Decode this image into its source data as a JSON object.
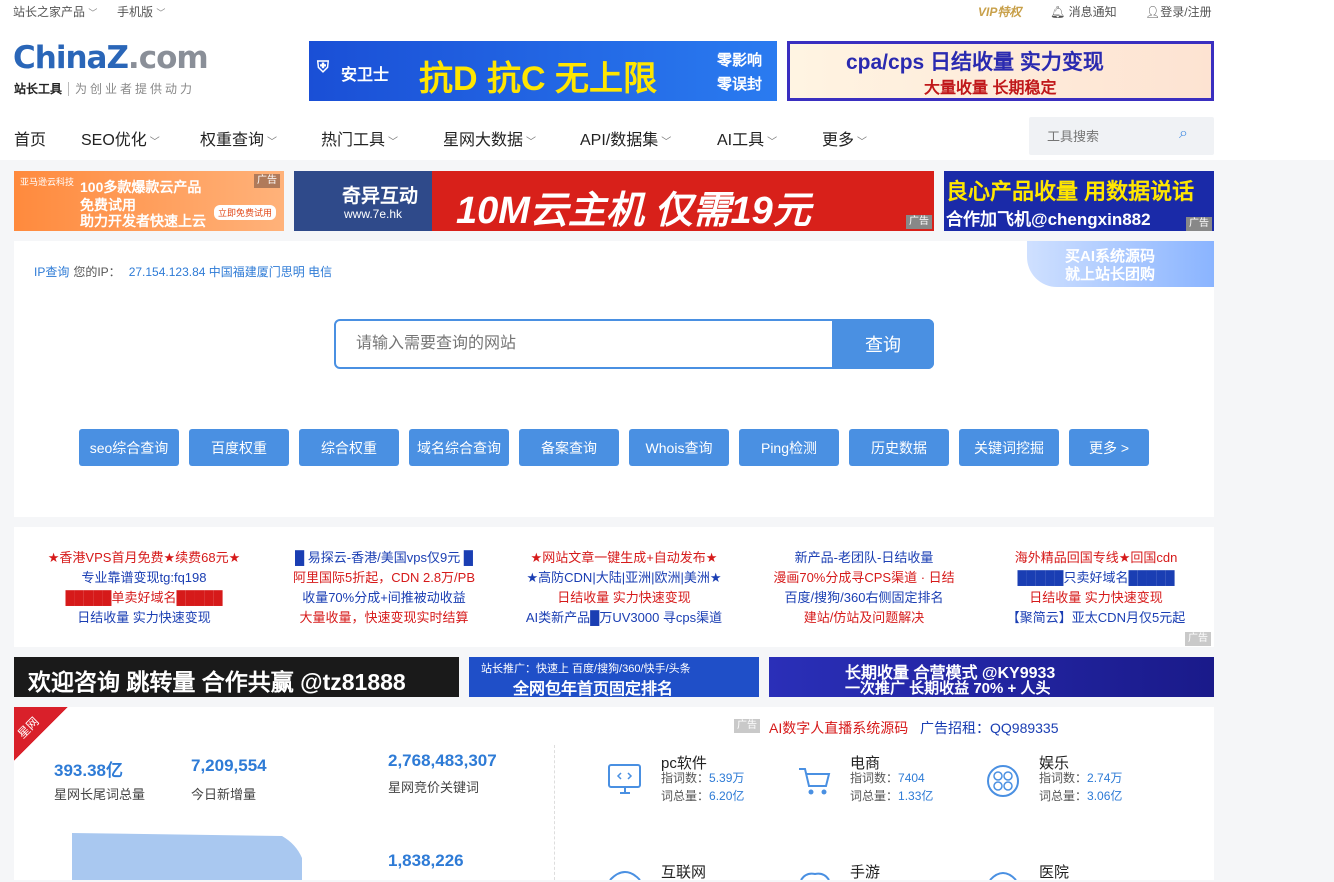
{
  "topbar": {
    "products": "站长之家产品",
    "mobile": "手机版",
    "vip": "VIP特权",
    "notify": "消息通知",
    "login": "登录/注册"
  },
  "logo": {
    "part1": "China",
    "part2": "Z",
    "part3": ".com",
    "tag": "站长工具",
    "slogan": "为创业者提供动力"
  },
  "header_ads": {
    "ad1_brand": "安卫士",
    "ad1_text": "抗D 抗C 无上限",
    "ad1_side1": "零影响",
    "ad1_side2": "零误封",
    "ad2_line1": "cpa/cps 日结收量 实力变现",
    "ad2_line2": "大量收量 长期稳定"
  },
  "nav": {
    "items": [
      "首页",
      "SEO优化",
      "权重查询",
      "热门工具",
      "星网大数据",
      "API/数据集",
      "AI工具",
      "更多"
    ],
    "search_placeholder": "工具搜索"
  },
  "ad_row": {
    "left_line1": "100多款爆款云产品",
    "left_line2": "免费试用",
    "left_line3": "助力开发者快速上云",
    "left_btn": "立即免费试用",
    "left_brand": "亚马逊云科技",
    "mid_brand": "奇异互动",
    "mid_url": "www.7e.hk",
    "mid_text": "10M云主机 仅需19元",
    "right_line1": "良心产品收量 用数据说话",
    "right_line2": "合作加飞机@chengxin882",
    "tag": "广告"
  },
  "ip": {
    "label": "IP查询",
    "your_ip": "您的IP：",
    "value": "27.154.123.84 中国福建厦门思明 电信"
  },
  "side_ad": {
    "line1": "买AI系统源码",
    "line2": "就上站长团购"
  },
  "main_search": {
    "placeholder": "请输入需要查询的网站",
    "button": "查询"
  },
  "quick_buttons": [
    "seo综合查询",
    "百度权重",
    "综合权重",
    "域名综合查询",
    "备案查询",
    "Whois查询",
    "Ping检测",
    "历史数据",
    "关键词挖掘",
    "更多 >"
  ],
  "text_ads": [
    [
      "★香港VPS首月免费★续费68元★",
      "专业靠谱变现tg:fq198",
      "█████单卖好域名█████",
      "日结收量 实力快速变现"
    ],
    [
      "█ 易探云-香港/美国vps仅9元 █",
      "阿里国际5折起，CDN 2.8万/PB",
      "收量70%分成+间推被动收益",
      "大量收量，快速变现实时结算"
    ],
    [
      "★网站文章一键生成+自动发布★",
      "★高防CDN|大陆|亚洲|欧洲|美洲★",
      "日结收量 实力快速变现",
      "AI类新产品█万UV3000 寻cps渠道"
    ],
    [
      "新产品-老团队-日结收量",
      "漫画70%分成寻CPS渠道 · 日结",
      "百度/搜狗/360右侧固定排名",
      "建站/仿站及问题解决"
    ],
    [
      "海外精品回国专线★回国cdn",
      "█████只卖好域名█████",
      "日结收量 实力快速变现",
      "【聚简云】亚太CDN月仅5元起"
    ]
  ],
  "banner_row": {
    "b1": "欢迎咨询 跳转量 合作共赢 @tz81888",
    "b2_line1": "站长推广：快速上 百度/搜狗/360/快手/头条",
    "b2_line2": "全网包年首页固定排名",
    "b3_line1": "长期收量 合营模式 @KY9933",
    "b3_line2": "一次推广 长期收益 70% + 人头"
  },
  "stats": {
    "corner": "星网",
    "ad_source": "AI数字人直播系统源码",
    "ad_contact": "广告招租：QQ989335",
    "n1": "393.38亿",
    "n1_label": "星网长尾词总量",
    "n2": "7,209,554",
    "n2_label": "今日新增量",
    "n3": "2,768,483,307",
    "n3_label": "星网竞价关键词",
    "n4": "1,838,226",
    "categories": [
      {
        "name": "pc软件",
        "l1": "指词数：",
        "v1": "5.39万",
        "l2": "词总量：",
        "v2": "6.20亿"
      },
      {
        "name": "电商",
        "l1": "指词数：",
        "v1": "7404",
        "l2": "词总量：",
        "v2": "1.33亿"
      },
      {
        "name": "娱乐",
        "l1": "指词数：",
        "v1": "2.74万",
        "l2": "词总量：",
        "v2": "3.06亿"
      },
      {
        "name": "互联网"
      },
      {
        "name": "手游"
      },
      {
        "name": "医院"
      }
    ]
  },
  "colors": {
    "primary": "#4a90e2",
    "link": "#2e7bd6",
    "red": "#d61a1a"
  }
}
